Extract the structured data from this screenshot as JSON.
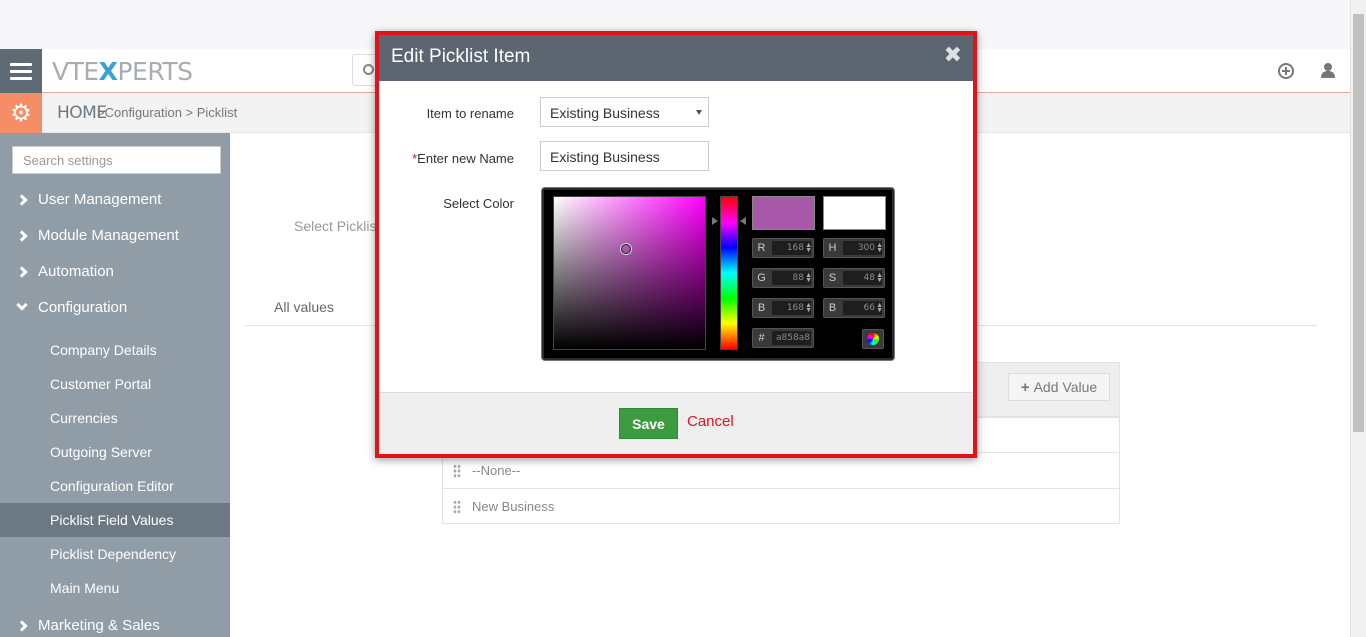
{
  "header": {
    "logo_prefix": "VTE",
    "logo_x": "X",
    "logo_suffix": "PERTS"
  },
  "breadcrumb": {
    "home": "HOME",
    "path": ">Configuration > Picklist"
  },
  "sidebar": {
    "search_placeholder": "Search settings",
    "sections": [
      {
        "label": "User Management"
      },
      {
        "label": "Module Management"
      },
      {
        "label": "Automation"
      },
      {
        "label": "Configuration"
      },
      {
        "label": "Marketing & Sales"
      }
    ],
    "items": [
      {
        "label": "Company Details"
      },
      {
        "label": "Customer Portal"
      },
      {
        "label": "Currencies"
      },
      {
        "label": "Outgoing Server"
      },
      {
        "label": "Configuration Editor"
      },
      {
        "label": "Picklist Field Values"
      },
      {
        "label": "Picklist Dependency"
      },
      {
        "label": "Main Menu"
      }
    ]
  },
  "main": {
    "select_picklist_label": "Select Picklis",
    "tab_all_values": "All values",
    "add_value_label": "Add Value",
    "rows": [
      "--None--",
      "New Business"
    ]
  },
  "modal": {
    "title": "Edit Picklist Item",
    "close_glyph": "✖",
    "item_to_rename_label": "Item to rename",
    "item_to_rename_value": "Existing Business",
    "new_name_required": "*",
    "new_name_label": "Enter new Name",
    "new_name_value": "Existing Business",
    "select_color_label": "Select Color",
    "save_label": "Save",
    "cancel_label": "Cancel"
  },
  "color_picker": {
    "new_color": "#a858a8",
    "current_color": "#ffffff",
    "r": "168",
    "g": "88",
    "b": "168",
    "h": "300",
    "s": "48",
    "bv": "66",
    "hex": "a858a8",
    "labels": {
      "r": "R",
      "g": "G",
      "b": "B",
      "h": "H",
      "s": "S",
      "bv": "B",
      "hex": "#"
    }
  },
  "colors": {
    "accent_red": "#e0131b",
    "save_green": "#3d9b3f",
    "sidebar_bg": "#909da6",
    "modal_header": "#5b6670",
    "gear_orange": "#f58e66"
  }
}
